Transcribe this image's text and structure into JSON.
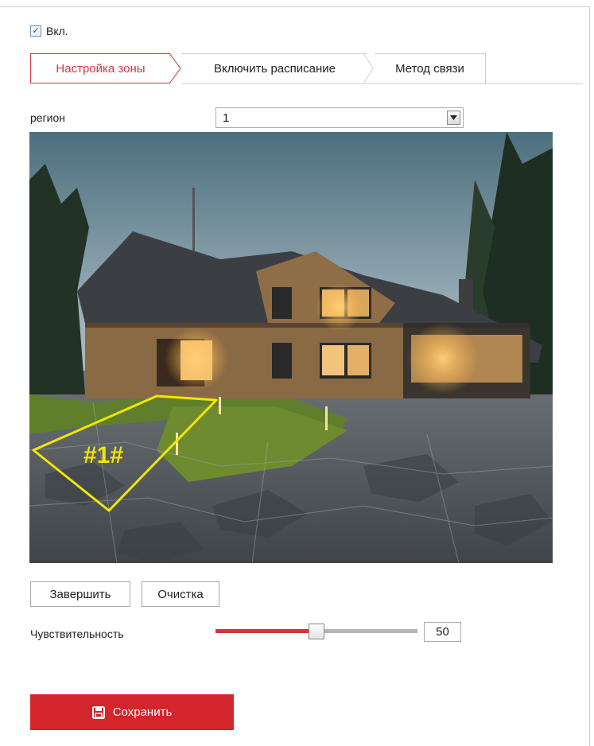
{
  "enable": {
    "label": "Вкл.",
    "checked": true
  },
  "tabs": [
    {
      "label": "Настройка зоны",
      "active": true
    },
    {
      "label": "Включить расписание",
      "active": false
    },
    {
      "label": "Метод связи",
      "active": false
    }
  ],
  "region": {
    "label": "регион",
    "value": "1"
  },
  "video": {
    "zone_label": "#1#",
    "zone_color": "#f2e600"
  },
  "buttons": {
    "finish": "Завершить",
    "clear": "Очистка"
  },
  "sensitivity": {
    "label": "Чувствительность",
    "value": "50",
    "level_percent": 50
  },
  "save": {
    "label": "Сохранить",
    "color": "#d4242c",
    "icon": "floppy-disk-icon"
  },
  "colors": {
    "accent": "#d4363d"
  }
}
